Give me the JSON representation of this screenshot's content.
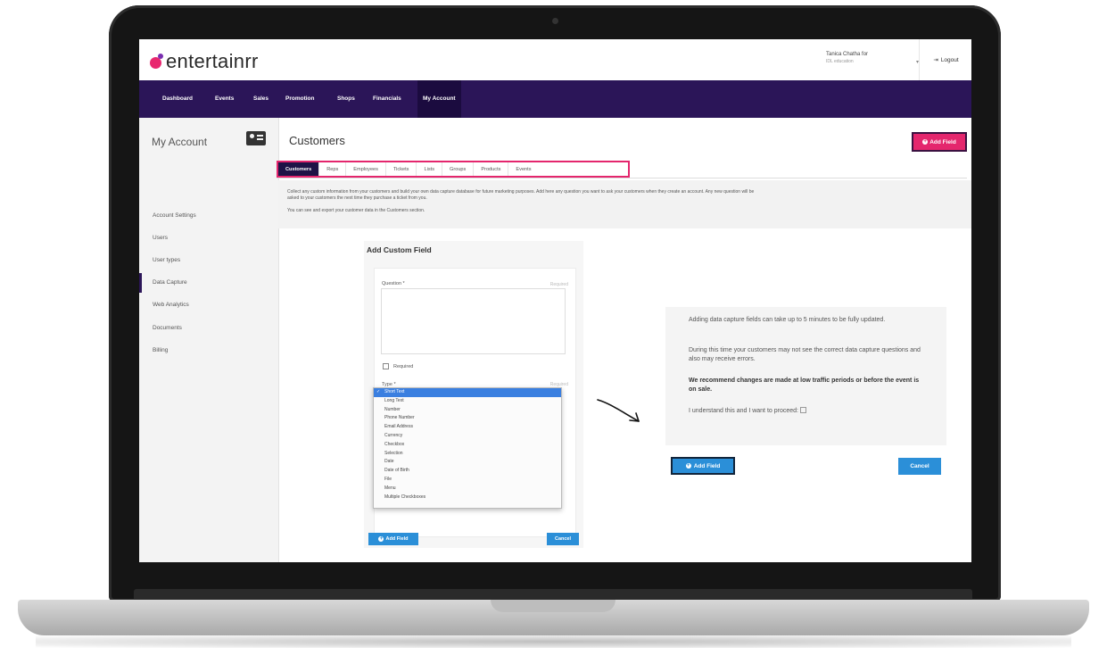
{
  "brand": {
    "name": "entertainrr"
  },
  "header": {
    "user_name": "Tanica Chatha for",
    "user_sub": "IDL education",
    "logout_label": "Logout"
  },
  "nav": {
    "items": [
      "Dashboard",
      "Events",
      "Sales",
      "Promotion",
      "Shops",
      "Financials",
      "My Account"
    ],
    "active": "My Account"
  },
  "sidebar": {
    "title": "My Account",
    "items": [
      "Account Settings",
      "Users",
      "User types",
      "Data Capture",
      "Web Analytics",
      "Documents",
      "Billing"
    ],
    "active": "Data Capture"
  },
  "page": {
    "title": "Customers",
    "add_field_label": "Add Field"
  },
  "tabs": [
    "Customers",
    "Reps",
    "Employees",
    "Tickets",
    "Lists",
    "Groups",
    "Products",
    "Events"
  ],
  "info": {
    "line1": "Collect any custom information from your customers and build your own data capture database for future marketing purposes. Add here any question you want to ask your customers when they create an account. Any new question will be",
    "line2": "asked to your customers the next time they purchase a ticket from you.",
    "line3": "You can see and export your customer data in the Customers section."
  },
  "custom_field_form": {
    "title": "Add Custom Field",
    "question_label": "Question *",
    "required_hint": "Required",
    "required_checkbox_label": "Required",
    "type_label": "Type *",
    "type_options": [
      "Short Text",
      "Long Text",
      "Number",
      "Phone Number",
      "Email Address",
      "Currency",
      "Checkbox",
      "Selection",
      "Date",
      "Date of Birth",
      "File",
      "Menu",
      "Multiple Checkboxes"
    ],
    "selected_type": "Short Text",
    "add_button": "Add Field",
    "cancel_button": "Cancel"
  },
  "warning": {
    "p1": "Adding data capture fields can take up to 5 minutes to be fully updated.",
    "p2": "During this time your customers may not see the correct data capture questions and also may receive errors.",
    "p3": "We recommend changes are made at low traffic periods or before the event is on sale.",
    "p4": "I understand this and I want to proceed:",
    "add_button": "Add Field",
    "cancel_button": "Cancel"
  },
  "colors": {
    "nav_bg": "#2b1558",
    "accent_pink": "#e4266d",
    "button_blue": "#2b8fd8"
  }
}
